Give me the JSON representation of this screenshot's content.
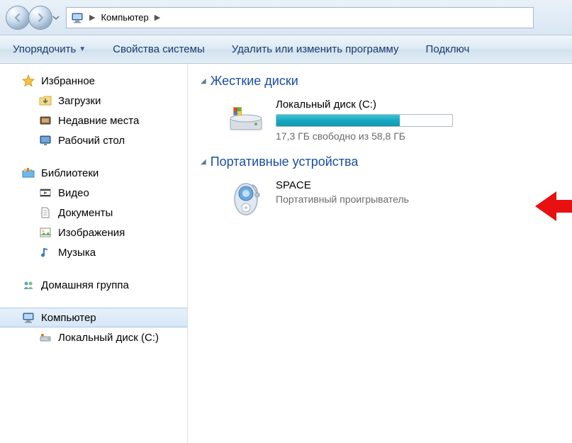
{
  "nav": {
    "location": "Компьютер"
  },
  "toolbar": {
    "organize": "Упорядочить",
    "system_props": "Свойства системы",
    "uninstall": "Удалить или изменить программу",
    "connect": "Подключ"
  },
  "sidebar": {
    "favorites": {
      "label": "Избранное"
    },
    "downloads": {
      "label": "Загрузки"
    },
    "recent": {
      "label": "Недавние места"
    },
    "desktop": {
      "label": "Рабочий стол"
    },
    "libraries": {
      "label": "Библиотеки"
    },
    "videos": {
      "label": "Видео"
    },
    "documents": {
      "label": "Документы"
    },
    "pictures": {
      "label": "Изображения"
    },
    "music": {
      "label": "Музыка"
    },
    "homegroup": {
      "label": "Домашняя группа"
    },
    "computer": {
      "label": "Компьютер"
    },
    "local_disk": {
      "label": "Локальный диск (C:)"
    }
  },
  "content": {
    "section_hdd": "Жесткие диски",
    "drive_c": {
      "title": "Локальный диск (C:)",
      "usage_text": "17,3 ГБ свободно из 58,8 ГБ",
      "fill_pct": 70
    },
    "section_portable": "Портативные устройства",
    "device": {
      "title": "SPACE",
      "subtitle": "Портативный проигрыватель"
    }
  }
}
